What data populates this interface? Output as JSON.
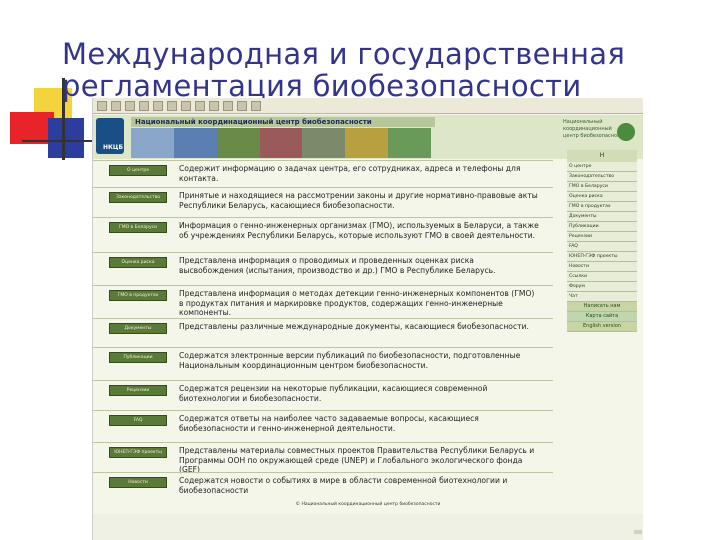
{
  "slide": {
    "title_line1": "Международная и государственная",
    "title_line2": "регламентация биобезопасности"
  },
  "website": {
    "logo_text": "НКЦБ",
    "org_name": "Национальный координационный центр биобезопасности",
    "side_logo_lines": [
      "Национальный",
      "координационный",
      "центр биобезопасности"
    ],
    "sections": [
      {
        "button": "О центре",
        "text": "Содержит информацию о задачах центра, его сотрудниках, адреса и телефоны для контакта."
      },
      {
        "button": "Законодательство",
        "text": "Принятые и находящиеся на рассмотрении законы и другие нормативно-правовые акты Республики Беларусь, касающиеся биобезопасности."
      },
      {
        "button": "ГМО в Беларуси",
        "text": "Информация о генно-инженерных организмах (ГМО), используемых в Беларуси, а также об учреждениях Республики Беларусь, которые используют ГМО в своей деятельности."
      },
      {
        "button": "Оценка риска",
        "text": "Представлена информация о проводимых и проведенных оценках риска высвобождения (испытания, производство и др.) ГМО в Республике Беларусь."
      },
      {
        "button": "ГМО в продуктах",
        "text": "Представлена информация о методах детекции генно-инженерных компонентов (ГМО) в продуктах питания и маркировке продуктов, содержащих генно-инженерные компоненты."
      },
      {
        "button": "Документы",
        "text": "Представлены различные международные документы, касающиеся биобезопасности."
      },
      {
        "button": "Публикации",
        "text": "Содержатся электронные версии публикаций по биобезопасности, подготовленные Национальным координационным центром биобезопасности."
      },
      {
        "button": "Рецензии",
        "text": "Содержатся рецензии на некоторые публикации, касающиеся современной биотехнологии и биобезопасности."
      },
      {
        "button": "FAQ",
        "text": "Содержатся ответы на наиболее часто задаваемые вопросы, касающиеся биобезопасности и генно-инженерной деятельности."
      },
      {
        "button": "ЮНЕП-ГЭФ проекты",
        "text": "Представлены материалы совместных проектов Правительства Республики Беларусь и Программы ООН по окружающей среде (UNEP) и Глобального экологического фонда (GEF)"
      },
      {
        "button": "Новости",
        "text": "Содержатся новости о событиях в мире в области современной биотехнологии и биобезопасности"
      }
    ],
    "nav": {
      "head": "H",
      "items": [
        "О центре",
        "Законодательство",
        "ГМО в Беларуси",
        "Оценка риска",
        "ГМО в продуктах",
        "Документы",
        "Публикации",
        "Рецензии",
        "FAQ",
        "ЮНЕП-ГЭФ проекты",
        "Новости",
        "Ссылки",
        "Форум",
        "Чат"
      ],
      "links": [
        "Написать нам",
        "Карта сайта",
        "English version"
      ]
    },
    "footer": "© Национальный координационный центр биобезопасности"
  },
  "colors": {
    "title": "#34348a",
    "button": "#5a7a3a",
    "banner": "#dde6c6"
  }
}
